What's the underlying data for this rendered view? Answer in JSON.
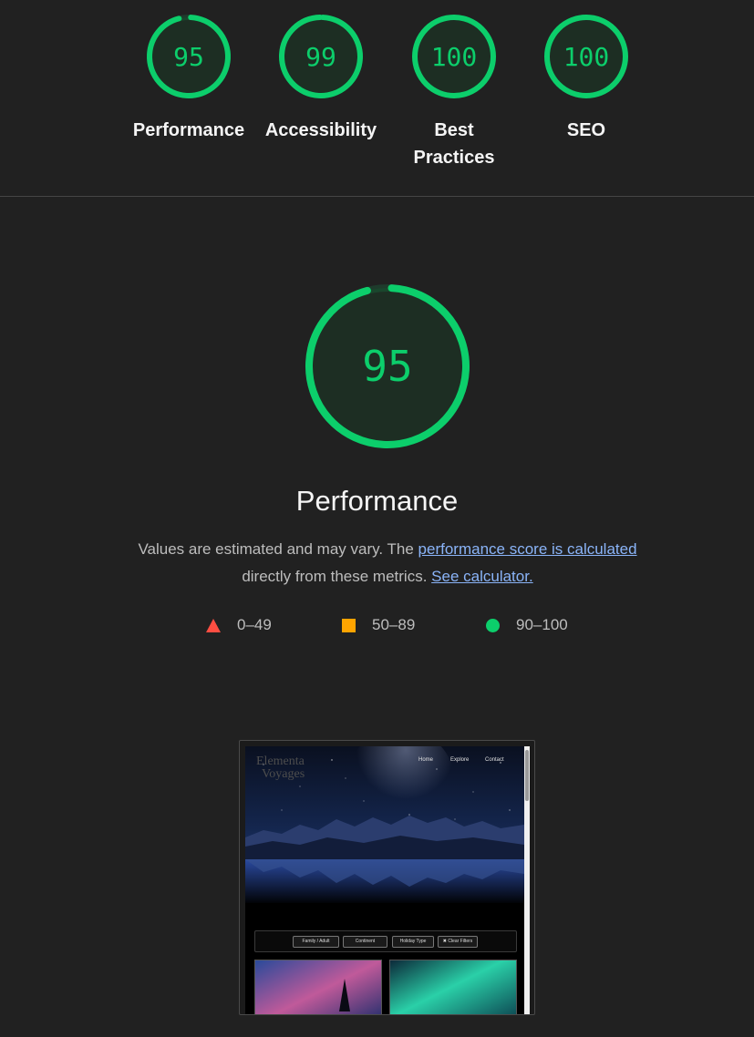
{
  "summary": [
    {
      "score": "95",
      "label": "Performance"
    },
    {
      "score": "99",
      "label": "Accessibility"
    },
    {
      "score": "100",
      "label": "Best Practices"
    },
    {
      "score": "100",
      "label": "SEO"
    }
  ],
  "main": {
    "score": "95",
    "title": "Performance",
    "desc_prefix": "Values are estimated and may vary. The ",
    "desc_link": "performance score is calculated",
    "desc_middle": "directly from these metrics.",
    "calculator_link": "See calculator."
  },
  "legend": [
    {
      "range": "0–49",
      "shape": "triangle",
      "color": "#ff4e42"
    },
    {
      "range": "50–89",
      "shape": "square",
      "color": "#ffa400"
    },
    {
      "range": "90–100",
      "shape": "circle",
      "color": "#0cce6b"
    }
  ],
  "thumbnail": {
    "logo_line1": "Elementa",
    "logo_line2": "Voyages",
    "nav": [
      "Home",
      "Explore",
      "Contact"
    ],
    "filters": [
      "Family / Adult",
      "Continent",
      "Holiday Type",
      "✖ Clear Filters"
    ]
  },
  "colors": {
    "pass": "#0cce6b",
    "average": "#ffa400",
    "fail": "#ff4e42",
    "background": "#212121",
    "link": "#8ab4f8"
  }
}
